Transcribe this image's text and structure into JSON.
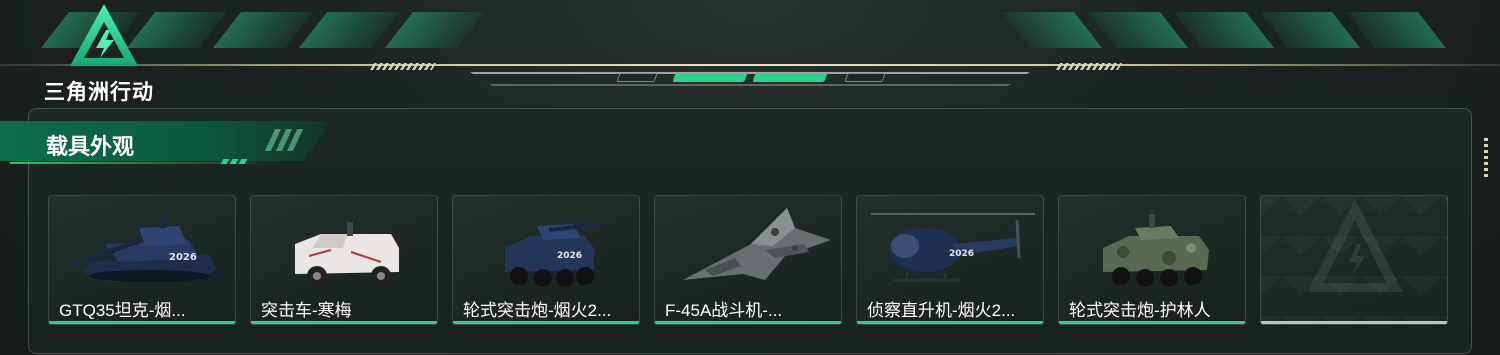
{
  "app": {
    "logo_text": "三角洲行动"
  },
  "section": {
    "title": "载具外观"
  },
  "colors": {
    "accent": "#2fd08e",
    "panel": "#1b2823",
    "title_bg": "#0f6b4c"
  },
  "cards": [
    {
      "name": "GTQ35坦克-烟...",
      "icon": "tank-icon"
    },
    {
      "name": "突击车-寒梅",
      "icon": "assault-vehicle-icon"
    },
    {
      "name": "轮式突击炮-烟火2...",
      "icon": "wheeled-assault-gun-icon"
    },
    {
      "name": "F-45A战斗机-...",
      "icon": "fighter-jet-icon"
    },
    {
      "name": "侦察直升机-烟火2...",
      "icon": "helicopter-icon"
    },
    {
      "name": "轮式突击炮-护林人",
      "icon": "wheeled-assault-gun-icon"
    },
    {
      "name": "",
      "icon": "empty-slot-logo-icon"
    }
  ]
}
